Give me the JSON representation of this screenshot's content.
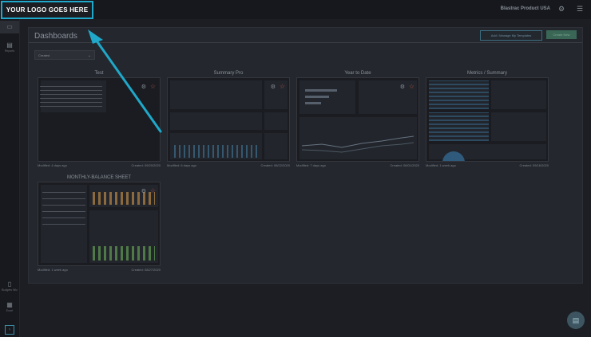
{
  "header": {
    "logo_text": "YOUR LOGO GOES HERE",
    "product_name": "Blastrac Product USA",
    "settings_icon": "gear-icon",
    "menu_icon": "hamburger-menu-icon"
  },
  "sidebar": {
    "items": [
      {
        "icon": "dashboard-icon",
        "label": ""
      },
      {
        "icon": "report-icon",
        "label": "Reports"
      }
    ],
    "bottom": [
      {
        "icon": "budget-icon",
        "label": "Budgets Wiz"
      },
      {
        "icon": "grid-icon",
        "label": "Excel"
      },
      {
        "icon": "expand-icon",
        "label": ""
      }
    ]
  },
  "page": {
    "title": "Dashboards",
    "manage_button": "Add / Manage My Templates",
    "create_button": "Create New",
    "filter_value": "Created"
  },
  "cards": [
    {
      "title": "Test",
      "modified": "Modified: 4 days ago",
      "created": "Created: 09/20/2020"
    },
    {
      "title": "Summary Pro",
      "modified": "Modified: 6 days ago",
      "created": "Created: 08/22/2020"
    },
    {
      "title": "Year to Date",
      "modified": "Modified: 7 days ago",
      "created": "Created: 06/01/2020"
    },
    {
      "title": "Metrics / Summary",
      "modified": "Modified: 1 week ago",
      "created": "Created: 09/16/2020"
    },
    {
      "title": "MONTHLY-BALANCE SHEET",
      "modified": "Modified: 1 week ago",
      "created": "Created: 08/27/2020"
    }
  ],
  "colors": {
    "accent": "#1fa8c9",
    "star": "#b2544a",
    "background": "#1c1e24"
  }
}
